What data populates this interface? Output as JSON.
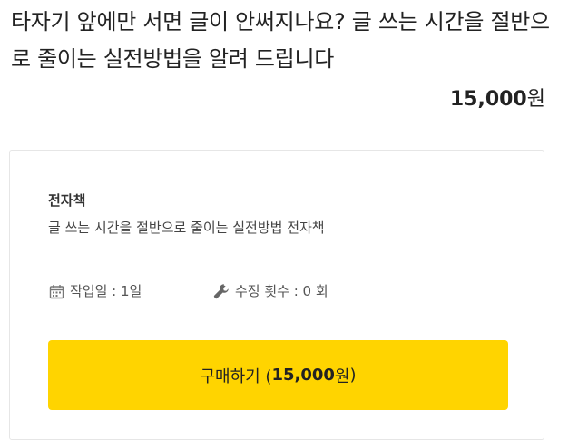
{
  "gig": {
    "title": "타자기 앞에만 서면 글이 안써지나요? 글 쓰는 시간을 절반으로 줄이는 실전방법을 알려 드립니다",
    "price_amount": "15,000",
    "price_unit": "원"
  },
  "package": {
    "name": "전자책",
    "description": "글 쓰는 시간을 절반으로 줄이는 실전방법 전자책",
    "work_days_label": "작업일 : 1일",
    "revisions_label": "수정 횟수 : 0 회",
    "buy_button": {
      "label": "구매하기 (",
      "amount": "15,000",
      "unit": "원",
      "close": ")",
      "color": "#ffd400"
    }
  },
  "icons": {
    "work_days": "calendar-icon",
    "revisions": "wrench-icon"
  }
}
